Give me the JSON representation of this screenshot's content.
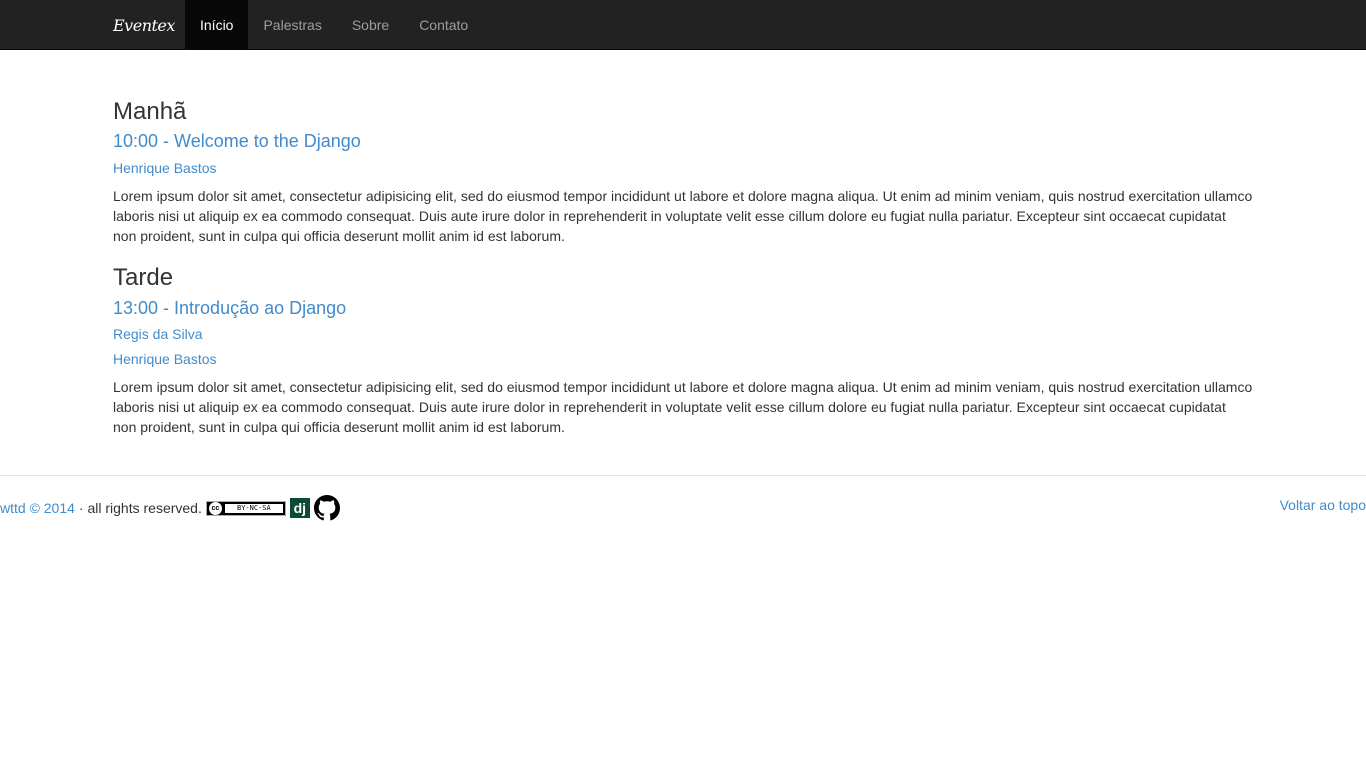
{
  "navbar": {
    "brand": "Eventex",
    "items": [
      {
        "label": "Início",
        "active": true
      },
      {
        "label": "Palestras",
        "active": false
      },
      {
        "label": "Sobre",
        "active": false
      },
      {
        "label": "Contato",
        "active": false
      }
    ]
  },
  "schedule": {
    "morning": {
      "heading": "Manhã",
      "talk": {
        "title": "10:00 - Welcome to the Django",
        "speakers": [
          "Henrique Bastos"
        ],
        "description": "Lorem ipsum dolor sit amet, consectetur adipisicing elit, sed do eiusmod tempor incididunt ut labore et dolore magna aliqua. Ut enim ad minim veniam, quis nostrud exercitation ullamco laboris nisi ut aliquip ex ea commodo consequat. Duis aute irure dolor in reprehenderit in voluptate velit esse cillum dolore eu fugiat nulla pariatur. Excepteur sint occaecat cupidatat non proident, sunt in culpa qui officia deserunt mollit anim id est laborum."
      }
    },
    "afternoon": {
      "heading": "Tarde",
      "talk": {
        "title": "13:00 - Introdução ao Django",
        "speakers": [
          "Regis da Silva",
          "Henrique Bastos"
        ],
        "description": "Lorem ipsum dolor sit amet, consectetur adipisicing elit, sed do eiusmod tempor incididunt ut labore et dolore magna aliqua. Ut enim ad minim veniam, quis nostrud exercitation ullamco laboris nisi ut aliquip ex ea commodo consequat. Duis aute irure dolor in reprehenderit in voluptate velit esse cillum dolore eu fugiat nulla pariatur. Excepteur sint occaecat cupidatat non proident, sunt in culpa qui officia deserunt mollit anim id est laborum."
      }
    }
  },
  "footer": {
    "copyright_link": "wttd © 2014",
    "rights_text": "· all rights reserved.",
    "cc_badge_text": "BY-NC-SA",
    "cc_symbol": "cc",
    "django_badge": "dj",
    "back_to_top": "Voltar ao topo"
  },
  "colors": {
    "navbar_bg": "#222222",
    "nav_active_bg": "#080808",
    "link": "#428bca",
    "text": "#333333",
    "django_green": "#0c4b33"
  },
  "icons": {
    "cc": "creative-commons-icon",
    "django": "django-icon",
    "github": "github-icon"
  }
}
